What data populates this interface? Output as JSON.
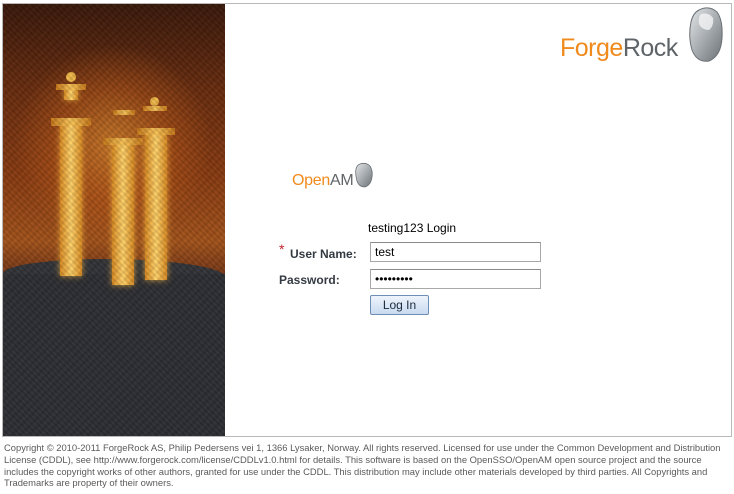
{
  "brand": {
    "forge": "Forge",
    "rock": "Rock",
    "open": "Open",
    "am": "AM",
    "colors": {
      "orange": "#f08a1c",
      "gray": "#5f6469"
    }
  },
  "login": {
    "title": "testing123 Login",
    "required_marker": "*",
    "user_label": "User Name:",
    "user_value": "test",
    "password_label": "Password:",
    "password_value": "testtest1",
    "button_label": "Log In"
  },
  "footer": {
    "text": "Copyright © 2010-2011 ForgeRock AS, Philip Pedersens vei 1, 1366 Lysaker, Norway. All rights reserved. Licensed for use under the Common Development and Distribution License (CDDL), see http://www.forgerock.com/license/CDDLv1.0.html for details. This software is based on the OpenSSO/OpenAM open source project and the source includes the copyright works of other authors, granted for use under the CDDL. This distribution may include other materials developed by third parties. All Copyrights and Trademarks are property of their owners."
  }
}
